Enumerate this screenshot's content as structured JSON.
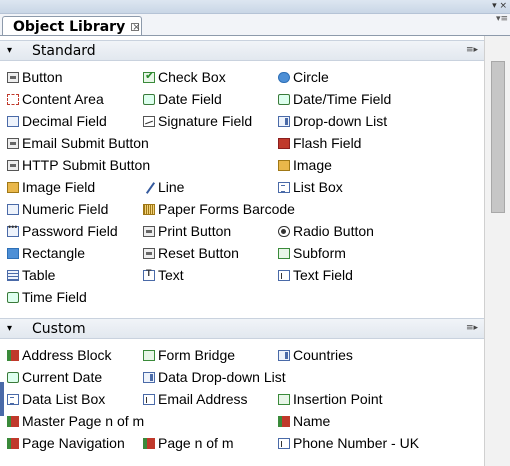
{
  "window": {
    "menu_icon": "▾ ×",
    "tab_title": "Object Library",
    "tab_close": "×",
    "tab_menu_icon": "▾≡"
  },
  "categories": [
    {
      "label": "Standard",
      "toggle": "▾",
      "options_icon": "≡▸",
      "items": [
        {
          "label": "Button",
          "icon": "button-icon"
        },
        {
          "label": "Check Box",
          "icon": "check-box-icon"
        },
        {
          "label": "Circle",
          "icon": "circle-icon"
        },
        {
          "label": "Content Area",
          "icon": "content-area-icon"
        },
        {
          "label": "Date Field",
          "icon": "date-field-icon"
        },
        {
          "label": "Date/Time Field",
          "icon": "date-time-field-icon"
        },
        {
          "label": "Decimal Field",
          "icon": "decimal-field-icon"
        },
        {
          "label": "Signature Field",
          "icon": "signature-field-icon"
        },
        {
          "label": "Drop-down List",
          "icon": "drop-down-list-icon"
        },
        {
          "label": "Email Submit Button",
          "icon": "email-submit-button-icon"
        },
        {
          "label": "Flash Field",
          "icon": "flash-field-icon"
        },
        {
          "label": "HTTP Submit Button",
          "icon": "http-submit-button-icon"
        },
        {
          "label": "Image",
          "icon": "image-icon"
        },
        {
          "label": "Image Field",
          "icon": "image-field-icon"
        },
        {
          "label": "Line",
          "icon": "line-icon"
        },
        {
          "label": "List Box",
          "icon": "list-box-icon"
        },
        {
          "label": "Numeric Field",
          "icon": "numeric-field-icon"
        },
        {
          "label": "Paper Forms Barcode",
          "icon": "barcode-icon"
        },
        {
          "label": "Password Field",
          "icon": "password-field-icon"
        },
        {
          "label": "Print Button",
          "icon": "print-button-icon"
        },
        {
          "label": "Radio Button",
          "icon": "radio-button-icon"
        },
        {
          "label": "Rectangle",
          "icon": "rectangle-icon"
        },
        {
          "label": "Reset Button",
          "icon": "reset-button-icon"
        },
        {
          "label": "Subform",
          "icon": "subform-icon"
        },
        {
          "label": "Table",
          "icon": "table-icon"
        },
        {
          "label": "Text",
          "icon": "text-icon"
        },
        {
          "label": "Text Field",
          "icon": "text-field-icon"
        },
        {
          "label": "Time Field",
          "icon": "time-field-icon"
        }
      ]
    },
    {
      "label": "Custom",
      "toggle": "▾",
      "options_icon": "≡▸",
      "items": [
        {
          "label": "Address Block",
          "icon": "custom-object-icon"
        },
        {
          "label": "Form Bridge",
          "icon": "form-bridge-icon"
        },
        {
          "label": "Countries",
          "icon": "drop-down-list-icon"
        },
        {
          "label": "Current Date",
          "icon": "date-field-icon"
        },
        {
          "label": "Data Drop-down List",
          "icon": "drop-down-list-icon"
        },
        {
          "label": "Data List Box",
          "icon": "list-box-icon"
        },
        {
          "label": "Email Address",
          "icon": "text-field-icon"
        },
        {
          "label": "Insertion Point",
          "icon": "subform-icon"
        },
        {
          "label": "Master Page n of m",
          "icon": "custom-object-icon"
        },
        {
          "label": "Name",
          "icon": "custom-object-icon"
        },
        {
          "label": "Page Navigation",
          "icon": "custom-object-icon"
        },
        {
          "label": "Page n of m",
          "icon": "custom-object-icon"
        },
        {
          "label": "Phone Number - UK",
          "icon": "text-field-icon"
        }
      ]
    }
  ]
}
